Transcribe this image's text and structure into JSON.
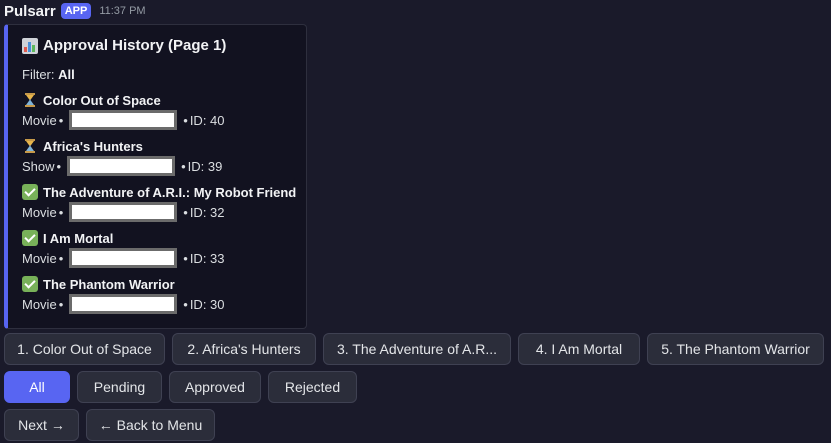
{
  "header": {
    "bot_name": "Pulsarr",
    "badge": "APP",
    "timestamp": "11:37 PM"
  },
  "embed": {
    "title": "Approval History (Page 1)",
    "filter_label": "Filter: ",
    "filter_value": "All",
    "accent_color": "#5865f2",
    "entries": [
      {
        "status": "pending",
        "status_icon": "hourglass-icon",
        "title": "Color Out of Space",
        "type": "Movie",
        "id": "ID: 40"
      },
      {
        "status": "pending",
        "status_icon": "hourglass-icon",
        "title": "Africa's Hunters",
        "type": "Show",
        "id": "ID: 39"
      },
      {
        "status": "approved",
        "status_icon": "check-icon",
        "title": "The Adventure of A.R.I.: My Robot Friend",
        "type": "Movie",
        "id": "ID: 32"
      },
      {
        "status": "approved",
        "status_icon": "check-icon",
        "title": "I Am Mortal",
        "type": "Movie",
        "id": "ID: 33"
      },
      {
        "status": "approved",
        "status_icon": "check-icon",
        "title": "The Phantom Warrior",
        "type": "Movie",
        "id": "ID: 30"
      }
    ],
    "separator": "•"
  },
  "item_buttons": [
    "1. Color Out of Space",
    "2. Africa's Hunters",
    "3. The Adventure of A.R...",
    "4. I Am Mortal",
    "5. The Phantom Warrior"
  ],
  "filter_buttons": [
    {
      "label": "All",
      "active": true
    },
    {
      "label": "Pending",
      "active": false
    },
    {
      "label": "Approved",
      "active": false
    },
    {
      "label": "Rejected",
      "active": false
    }
  ],
  "nav_buttons": {
    "next": "Next →",
    "back": "← Back to Menu"
  },
  "colors": {
    "primary_button": "#5865f2",
    "check_green": "#78b159"
  }
}
